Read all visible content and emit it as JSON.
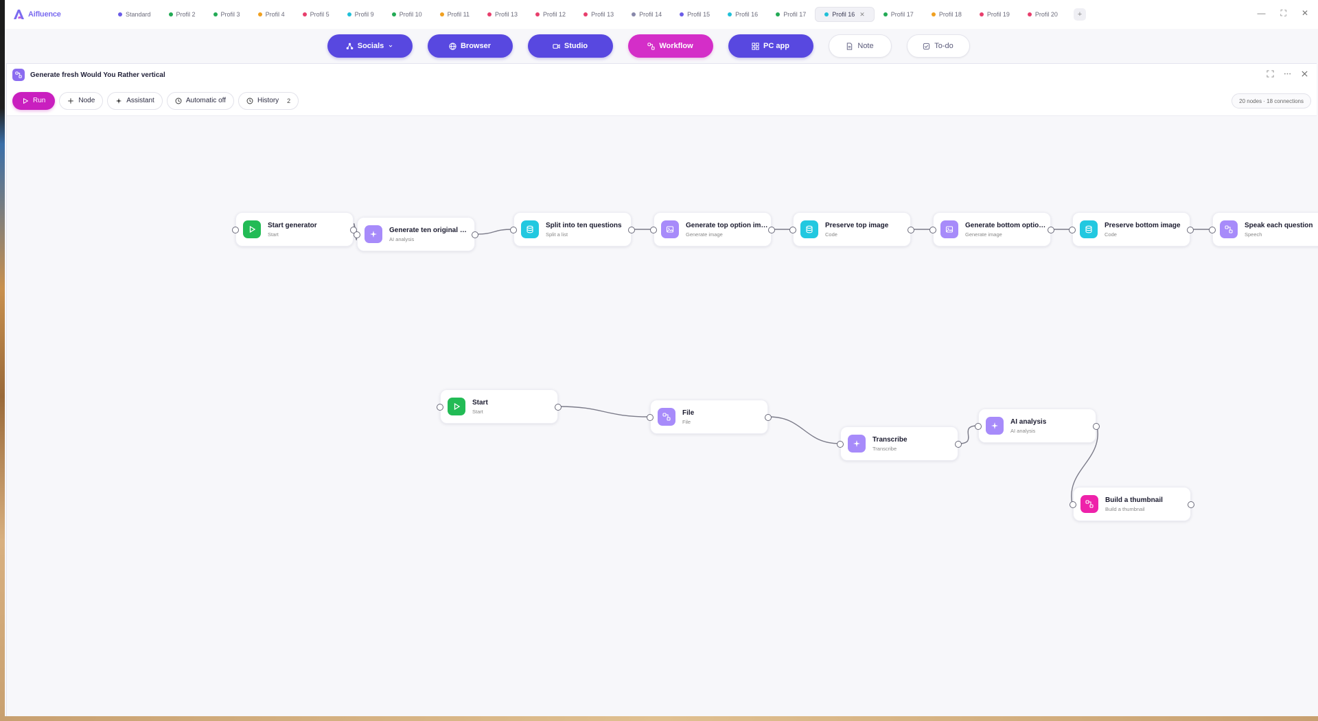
{
  "app": {
    "name": "Aifluence"
  },
  "profile_tabs": [
    {
      "label": "Standard",
      "color": "#6b5ce7"
    },
    {
      "label": "Profil 2",
      "color": "#22aa55"
    },
    {
      "label": "Profil 3",
      "color": "#22aa55"
    },
    {
      "label": "Profil 4",
      "color": "#f0a020"
    },
    {
      "label": "Profil 5",
      "color": "#e83e6c"
    },
    {
      "label": "Profil 9",
      "color": "#20c0d8"
    },
    {
      "label": "Profil 10",
      "color": "#22aa55"
    },
    {
      "label": "Profil 11",
      "color": "#f0a020"
    },
    {
      "label": "Profil 13",
      "color": "#e83e6c"
    },
    {
      "label": "Profil 12",
      "color": "#e83e6c"
    },
    {
      "label": "Profil 13",
      "color": "#e83e6c"
    },
    {
      "label": "Profil 14",
      "color": "#8888aa"
    },
    {
      "label": "Profil 15",
      "color": "#6b5ce7"
    },
    {
      "label": "Profil 16",
      "color": "#20c0d8"
    },
    {
      "label": "Profil 17",
      "color": "#22aa55"
    },
    {
      "label": "Profil 16",
      "color": "#20c0d8",
      "active": true
    },
    {
      "label": "Profil 17",
      "color": "#22aa55"
    },
    {
      "label": "Profil 18",
      "color": "#f0a020"
    },
    {
      "label": "Profil 19",
      "color": "#e83e6c"
    },
    {
      "label": "Profil 20",
      "color": "#e83e6c"
    }
  ],
  "add_tab_label": "+",
  "window_controls": {
    "minimize": "—",
    "maximize": "⛶",
    "close": "✕"
  },
  "nav": {
    "socials": "Socials",
    "browser": "Browser",
    "studio": "Studio",
    "workflow": "Workflow",
    "pc_app": "PC app",
    "note": "Note",
    "todo": "To-do"
  },
  "workflow": {
    "title": "Generate fresh Would You Rather vertical",
    "toolbar": {
      "run": "Run",
      "node": "Node",
      "assistant": "Assistant",
      "automatic": "Automatic off",
      "history": "History",
      "history_count": "2"
    },
    "stats": "20 nodes · 18 connections",
    "nodes": [
      {
        "title": "Start generator",
        "subtitle": "Start",
        "icon": "play-icon",
        "color": "green"
      },
      {
        "title": "Generate ten original Would You Rather questions",
        "subtitle": "AI analysis",
        "icon": "sparkle-icon",
        "color": "violet"
      },
      {
        "title": "Split into ten questions",
        "subtitle": "Split a list",
        "icon": "database-icon",
        "color": "cyan"
      },
      {
        "title": "Generate top option image",
        "subtitle": "Generate image",
        "icon": "image-icon",
        "color": "violet"
      },
      {
        "title": "Preserve top image",
        "subtitle": "Code",
        "icon": "database-icon",
        "color": "cyan"
      },
      {
        "title": "Generate bottom option image",
        "subtitle": "Generate image",
        "icon": "image-icon",
        "color": "violet"
      },
      {
        "title": "Preserve bottom image",
        "subtitle": "Code",
        "icon": "database-icon",
        "color": "cyan"
      },
      {
        "title": "Speak each question",
        "subtitle": "Speech",
        "icon": "workflow-icon",
        "color": "violet"
      },
      {
        "title": "Start",
        "subtitle": "Start",
        "icon": "play-icon",
        "color": "green"
      },
      {
        "title": "File",
        "subtitle": "File",
        "icon": "workflow-icon",
        "color": "violet"
      },
      {
        "title": "Transcribe",
        "subtitle": "Transcribe",
        "icon": "sparkle-icon",
        "color": "violet"
      },
      {
        "title": "AI analysis",
        "subtitle": "AI analysis",
        "icon": "sparkle-icon",
        "color": "violet"
      },
      {
        "title": "Build a thumbnail",
        "subtitle": "Build a thumbnail",
        "icon": "workflow-icon",
        "color": "magenta"
      }
    ]
  }
}
